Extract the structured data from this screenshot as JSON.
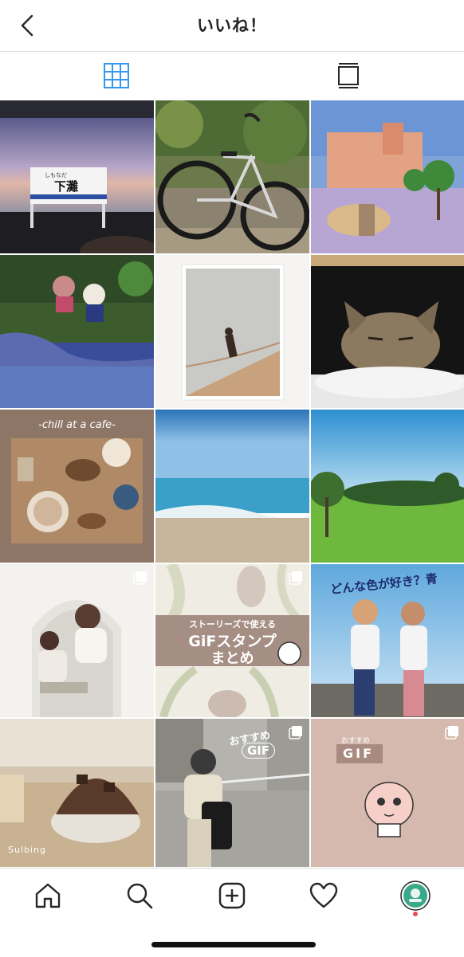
{
  "header": {
    "title": "いいね！"
  },
  "grid": {
    "cells": [
      {
        "id": 1,
        "station_name": "下灘",
        "station_reading": "しもなだ"
      },
      {
        "id": 2
      },
      {
        "id": 3
      },
      {
        "id": 4
      },
      {
        "id": 5
      },
      {
        "id": 6
      },
      {
        "id": 7,
        "caption": "-chill at a cafe-"
      },
      {
        "id": 8
      },
      {
        "id": 9
      },
      {
        "id": 10
      },
      {
        "id": 11,
        "line1": "ストーリーズで使える",
        "line2": "GiFスタンプ",
        "line3": "まとめ"
      },
      {
        "id": 12,
        "heading": "どんな色が好き？青"
      },
      {
        "id": 13,
        "caption": "Sulbing"
      },
      {
        "id": 14,
        "badge_top": "おすすめ",
        "badge_bottom": "GIF"
      },
      {
        "id": 15,
        "small": "おすすめ",
        "big": "GIF"
      }
    ]
  },
  "colors": {
    "accent": "#3897f0",
    "notification_dot": "#ed4956"
  }
}
